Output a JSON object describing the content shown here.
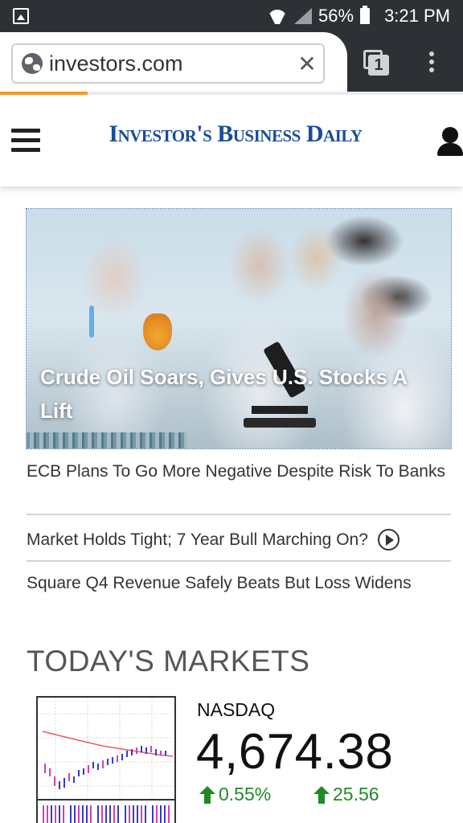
{
  "status_bar": {
    "battery": "56%",
    "time": "3:21 PM",
    "icons": [
      "image-icon",
      "wifi-icon",
      "signal-icon",
      "battery-icon"
    ]
  },
  "browser": {
    "url": "investors.com",
    "tab_count": "1",
    "load_progress": 0.19,
    "icons": [
      "globe-icon",
      "clear-icon",
      "tabs-icon",
      "overflow-menu-icon"
    ]
  },
  "site": {
    "logo_text": "Investor's Business Daily",
    "colors": {
      "logo_blue": "#1a4c99",
      "accent_orange": "#f29a2e",
      "positive_green": "#1e8a24"
    },
    "icons": [
      "hamburger-menu-icon",
      "user-account-icon"
    ]
  },
  "hero": {
    "caption": "Crude Oil Soars, Gives U.S. Stocks A Lift"
  },
  "headlines": [
    {
      "text": "ECB Plans To Go More Negative Despite Risk To Banks",
      "has_video": false
    },
    {
      "text": "Market Holds Tight; 7 Year Bull Marching On?",
      "has_video": true
    },
    {
      "text": "Square Q4 Revenue Safely Beats But Loss Widens",
      "has_video": false
    }
  ],
  "markets": {
    "title": "TODAY'S MARKETS",
    "index_name": "NASDAQ",
    "value": "4,674.38",
    "change_percent": "0.55%",
    "change_points": "25.56",
    "direction": "up"
  }
}
